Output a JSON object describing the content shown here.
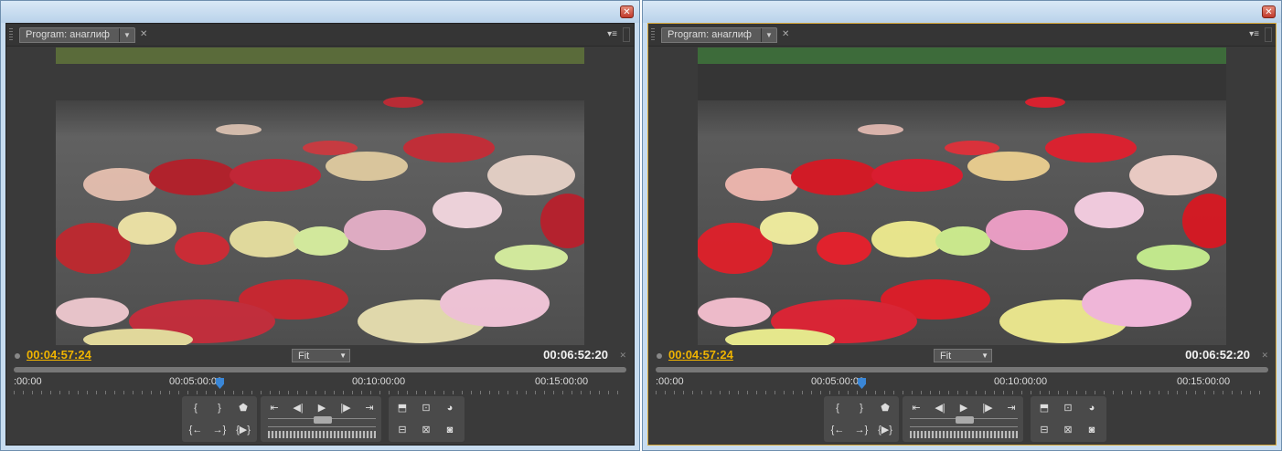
{
  "panels": [
    {
      "tab_label": "Program: анаглиф",
      "current_timecode": "00:04:57:24",
      "zoom": "Fit",
      "duration": "00:06:52:20",
      "ruler_labels": [
        ":00:00",
        "00:05:00:00",
        "00:10:00:00",
        "00:15:00:00"
      ],
      "active": false
    },
    {
      "tab_label": "Program: анаглиф",
      "current_timecode": "00:04:57:24",
      "zoom": "Fit",
      "duration": "00:06:52:20",
      "ruler_labels": [
        ":00:00",
        "00:05:00:00",
        "00:10:00:00",
        "00:15:00:00"
      ],
      "active": true
    }
  ],
  "playhead_fraction": 0.33,
  "colors": {
    "accent": "#f0b400",
    "active_border": "#d8a93a",
    "playhead": "#3a86d6",
    "panel_bg": "#3a3a3a"
  },
  "icons": {
    "close": "close-icon",
    "panel_menu": "panel-menu-icon",
    "mark_in": "mark-in-icon",
    "mark_out": "mark-out-icon",
    "marker": "marker-icon",
    "go_to_in": "go-to-in-icon",
    "step_back": "step-back-icon",
    "play": "play-icon",
    "step_forward": "step-forward-icon",
    "go_to_out": "go-to-out-icon",
    "lift": "lift-icon",
    "safe_margins": "safe-margins-icon",
    "output": "output-icon",
    "go_to_prev_edit": "go-to-previous-edit-icon",
    "go_to_next_edit": "go-to-next-edit-icon",
    "play_in_to_out": "play-in-to-out-icon",
    "extract": "extract-icon",
    "trim": "trim-icon",
    "export_frame": "camera-icon"
  }
}
